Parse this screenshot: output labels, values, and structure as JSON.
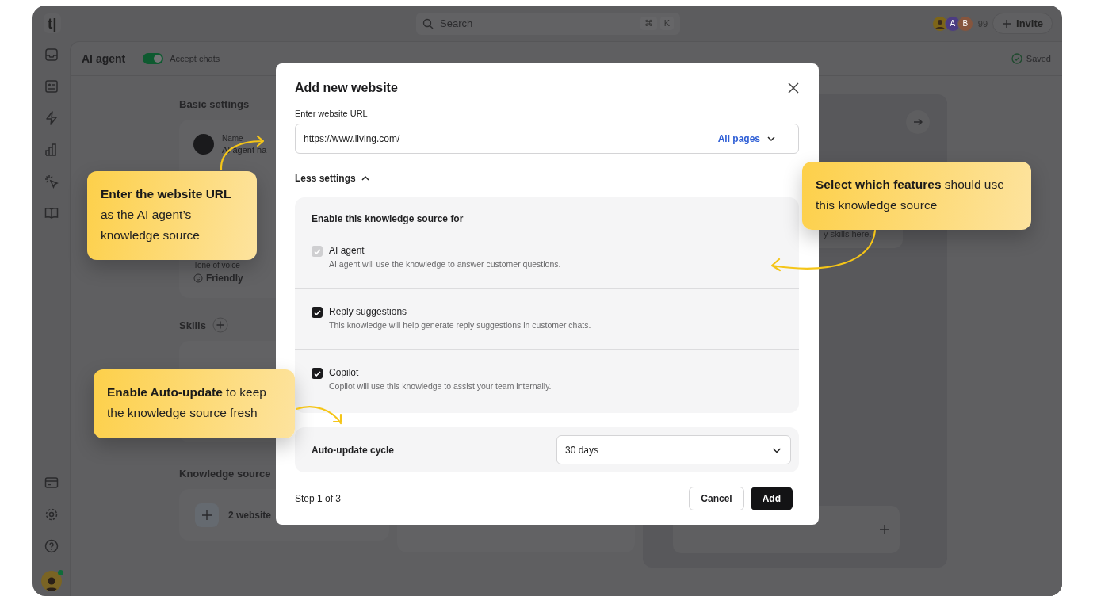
{
  "top_bar": {
    "logo": "t|",
    "search": {
      "placeholder": "Search",
      "shortcut": [
        "⌘",
        "K"
      ]
    },
    "avatars": [
      {
        "kind": "photo",
        "color": "#7d6518"
      },
      {
        "kind": "initial",
        "initial": "A",
        "color": "#4c3c82"
      },
      {
        "kind": "initial",
        "initial": "B",
        "color": "#86553d"
      }
    ],
    "member_count": "99",
    "invite": "Invite"
  },
  "user": {
    "online": true
  },
  "header": {
    "title": "AI agent",
    "toggle": {
      "label": "Accept chats",
      "on": true
    },
    "status": "Saved"
  },
  "basic_settings": {
    "heading": "Basic settings",
    "name_label": "Name",
    "name_value": "AI agent na",
    "tone_label": "Tone of voice",
    "tone_value": "Friendly"
  },
  "skills": {
    "heading": "Skills"
  },
  "knowledge": {
    "heading": "Knowledge source",
    "item": "2 website"
  },
  "right_panel": {
    "hint": "y skills here."
  },
  "modal": {
    "title": "Add new website",
    "url_label": "Enter website URL",
    "url_value": "https://www.living.com/",
    "scope": "All pages",
    "settings_toggle": "Less settings",
    "expanded": true,
    "features_heading": "Enable this knowledge source for",
    "features": [
      {
        "label": "AI agent",
        "description": "AI agent will use the knowledge to answer customer questions.",
        "checked": true,
        "disabled": true
      },
      {
        "label": "Reply suggestions",
        "description": "This knowledge will help generate reply suggestions in customer chats.",
        "checked": true,
        "disabled": false
      },
      {
        "label": "Copilot",
        "description": "Copilot will use this knowledge to assist your team internally.",
        "checked": true,
        "disabled": false
      }
    ],
    "auto_update": {
      "label": "Auto-update cycle",
      "value": "30 days"
    },
    "step": "Step 1 of 3",
    "buttons": [
      {
        "label": "Cancel",
        "kind": "secondary"
      },
      {
        "label": "Add",
        "kind": "primary"
      }
    ]
  },
  "callouts": [
    {
      "text": "**Enter the website URL** as the AI agent’s knowledge source"
    },
    {
      "text": "**Select which features** should use this knowledge source"
    },
    {
      "text": "**Enable Auto-update** to keep the knowledge source fresh"
    }
  ]
}
